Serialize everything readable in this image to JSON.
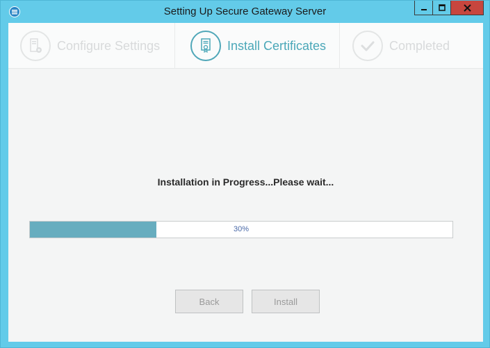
{
  "window": {
    "title": "Setting Up Secure Gateway Server",
    "controls": [
      "minimize",
      "maximize",
      "close"
    ]
  },
  "steps": [
    {
      "label": "Configure Settings",
      "icon": "server-gear-icon",
      "state": "done"
    },
    {
      "label": "Install Certificates",
      "icon": "certificate-icon",
      "state": "active"
    },
    {
      "label": "Completed",
      "icon": "checkmark-icon",
      "state": "pending"
    }
  ],
  "main": {
    "message": "Installation in Progress...Please wait...",
    "progress": {
      "value": 30,
      "label": "30%"
    }
  },
  "buttons": {
    "back_label": "Back",
    "install_label": "Install"
  },
  "colors": {
    "titlebar": "#63cbe9",
    "accent": "#4aa7b8",
    "progress_fill": "#67adbf",
    "close_button": "#c7463e"
  }
}
